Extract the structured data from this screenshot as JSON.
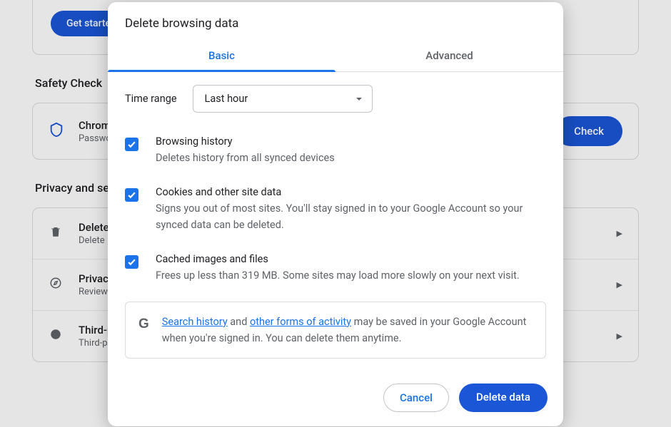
{
  "background": {
    "get_started": "Get started",
    "safety": {
      "title": "Safety Check",
      "row_title": "Chrome",
      "row_subtitle": "Passwords",
      "button": "Check"
    },
    "privacy_title": "Privacy and security",
    "rows": [
      {
        "title": "Delete browsing data",
        "subtitle": "Delete"
      },
      {
        "title": "Privacy",
        "subtitle": "Review"
      },
      {
        "title": "Third-party cookies",
        "subtitle": "Third-p"
      }
    ]
  },
  "dialog": {
    "title": "Delete browsing data",
    "tabs": {
      "basic": "Basic",
      "advanced": "Advanced"
    },
    "time_range_label": "Time range",
    "time_range_value": "Last hour",
    "options": [
      {
        "title": "Browsing history",
        "desc": "Deletes history from all synced devices",
        "checked": true
      },
      {
        "title": "Cookies and other site data",
        "desc": "Signs you out of most sites. You'll stay signed in to your Google Account so your synced data can be deleted.",
        "checked": true
      },
      {
        "title": "Cached images and files",
        "desc": "Frees up less than 319 MB. Some sites may load more slowly on your next visit.",
        "checked": true
      }
    ],
    "info": {
      "link1": "Search history",
      "mid1": " and ",
      "link2": "other forms of activity",
      "rest": " may be saved in your Google Account when you're signed in. You can delete them anytime."
    },
    "buttons": {
      "cancel": "Cancel",
      "delete": "Delete data"
    }
  }
}
